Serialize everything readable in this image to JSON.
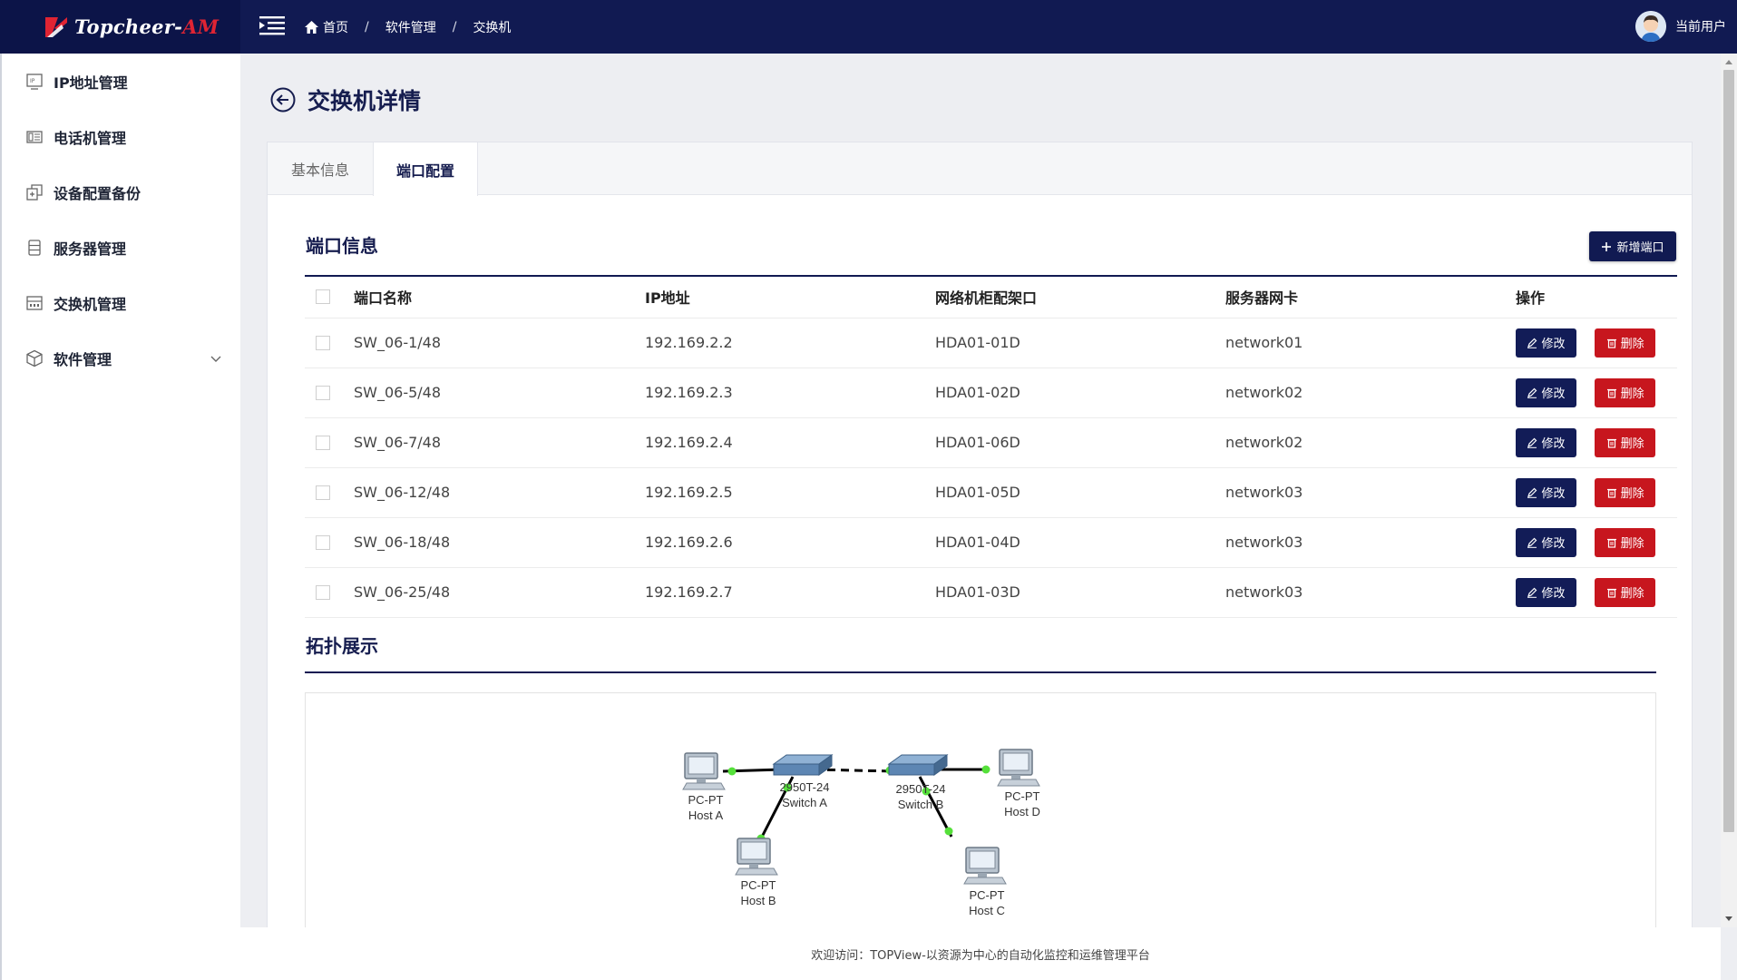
{
  "header": {
    "logo_prefix": "T",
    "logo_name": "opcheer-",
    "logo_suffix": "AM",
    "breadcrumbs": [
      "首页",
      "软件管理",
      "交换机"
    ],
    "breadcrumb_sep": "/",
    "user_name": "当前用户",
    "bar_color": "#111a52"
  },
  "sidebar": {
    "items": [
      {
        "label": "IP地址管理",
        "icon": "ip-icon"
      },
      {
        "label": "电话机管理",
        "icon": "phone-icon"
      },
      {
        "label": "设备配置备份",
        "icon": "backup-icon"
      },
      {
        "label": "服务器管理",
        "icon": "server-icon"
      },
      {
        "label": "交换机管理",
        "icon": "switch-icon"
      },
      {
        "label": "软件管理",
        "icon": "box-icon"
      }
    ]
  },
  "page": {
    "title": "交换机详情",
    "tabs": [
      "基本信息",
      "端口配置"
    ],
    "active_tab": "端口配置"
  },
  "ports": {
    "section_title": "端口信息",
    "add_button": "新增端口",
    "columns": [
      "端口名称",
      "IP地址",
      "网络机柜配架口",
      "服务器网卡",
      "操作"
    ],
    "edit_label": "修改",
    "delete_label": "删除",
    "rows": [
      {
        "name": "SW_06-1/48",
        "ip": "192.169.2.2",
        "rack": "HDA01-01D",
        "nic": "network01"
      },
      {
        "name": "SW_06-5/48",
        "ip": "192.169.2.3",
        "rack": "HDA01-02D",
        "nic": "network02"
      },
      {
        "name": "SW_06-7/48",
        "ip": "192.169.2.4",
        "rack": "HDA01-06D",
        "nic": "network02"
      },
      {
        "name": "SW_06-12/48",
        "ip": "192.169.2.5",
        "rack": "HDA01-05D",
        "nic": "network03"
      },
      {
        "name": "SW_06-18/48",
        "ip": "192.169.2.6",
        "rack": "HDA01-04D",
        "nic": "network03"
      },
      {
        "name": "SW_06-25/48",
        "ip": "192.169.2.7",
        "rack": "HDA01-03D",
        "nic": "network03"
      }
    ]
  },
  "topology": {
    "section_title": "拓扑展示",
    "switches": [
      {
        "model": "2950T-24",
        "name": "Switch A"
      },
      {
        "model": "2950T-24",
        "name": "Switch B"
      }
    ],
    "hosts": [
      {
        "type": "PC-PT",
        "name": "Host A"
      },
      {
        "type": "PC-PT",
        "name": "Host B"
      },
      {
        "type": "PC-PT",
        "name": "Host C"
      },
      {
        "type": "PC-PT",
        "name": "Host D"
      }
    ]
  },
  "footer": {
    "text": "欢迎访问：TOPView-以资源为中心的自动化监控和运维管理平台"
  },
  "colors": {
    "primary": "#111a52",
    "danger": "#c7161e",
    "link_dot": "#55e03a"
  }
}
